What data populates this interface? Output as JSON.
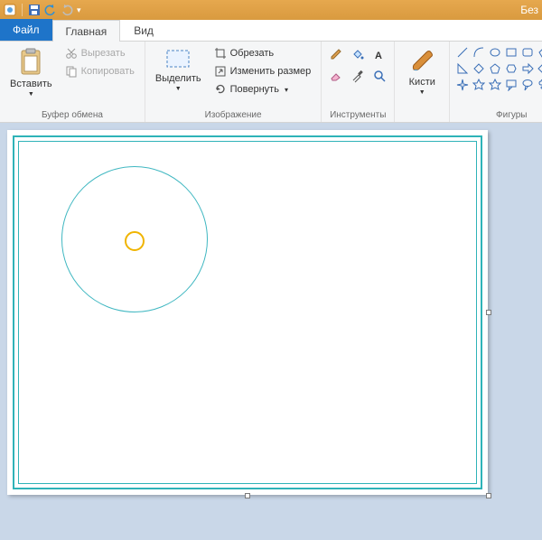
{
  "titlebar": {
    "title": "Без"
  },
  "tabs": {
    "file": "Файл",
    "home": "Главная",
    "view": "Вид"
  },
  "groups": {
    "clipboard": {
      "label": "Буфер обмена",
      "paste": "Вставить",
      "cut": "Вырезать",
      "copy": "Копировать"
    },
    "image": {
      "label": "Изображение",
      "select": "Выделить",
      "crop": "Обрезать",
      "resize": "Изменить размер",
      "rotate": "Повернуть"
    },
    "tools": {
      "label": "Инструменты"
    },
    "brushes": {
      "brushes": "Кисти"
    },
    "shapes": {
      "label": "Фигуры"
    }
  },
  "canvas": {
    "frame_color": "#2fb3b8",
    "big_circle": {
      "stroke": "#3fb7c1"
    },
    "small_circle": {
      "stroke": "#f0b400"
    }
  }
}
